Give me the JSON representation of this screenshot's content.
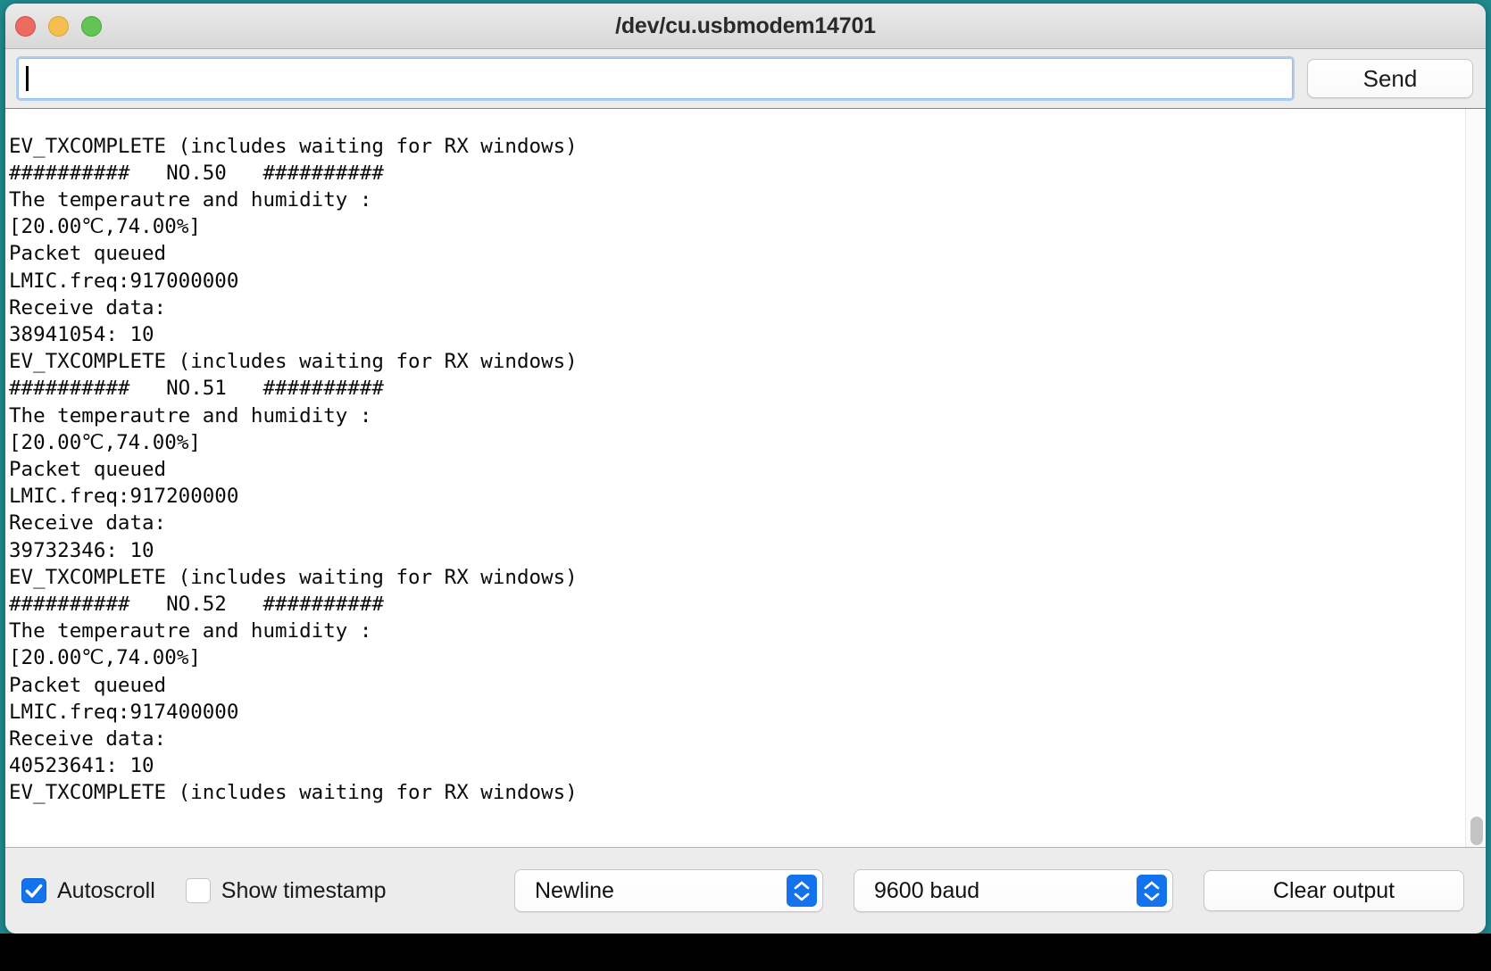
{
  "window": {
    "title": "/dev/cu.usbmodem14701",
    "traffic_lights": [
      {
        "name": "close",
        "color": "#ec6a5f"
      },
      {
        "name": "minimize",
        "color": "#f5bf4f"
      },
      {
        "name": "zoom",
        "color": "#61c454"
      }
    ]
  },
  "send_row": {
    "input_value": "",
    "input_placeholder": "",
    "send_label": "Send"
  },
  "console": {
    "text": "EV_TXCOMPLETE (includes waiting for RX windows)\n##########   NO.50   ##########\nThe temperautre and humidity :\n[20.00℃,74.00%]\nPacket queued\nLMIC.freq:917000000\nReceive data:\n38941054: 10\nEV_TXCOMPLETE (includes waiting for RX windows)\n##########   NO.51   ##########\nThe temperautre and humidity :\n[20.00℃,74.00%]\nPacket queued\nLMIC.freq:917200000\nReceive data:\n39732346: 10\nEV_TXCOMPLETE (includes waiting for RX windows)\n##########   NO.52   ##########\nThe temperautre and humidity :\n[20.00℃,74.00%]\nPacket queued\nLMIC.freq:917400000\nReceive data:\n40523641: 10\nEV_TXCOMPLETE (includes waiting for RX windows)",
    "lines": [
      "EV_TXCOMPLETE (includes waiting for RX windows)",
      "##########   NO.50   ##########",
      "The temperautre and humidity :",
      "[20.00℃,74.00%]",
      "Packet queued",
      "LMIC.freq:917000000",
      "Receive data:",
      "38941054: 10",
      "EV_TXCOMPLETE (includes waiting for RX windows)",
      "##########   NO.51   ##########",
      "The temperautre and humidity :",
      "[20.00℃,74.00%]",
      "Packet queued",
      "LMIC.freq:917200000",
      "Receive data:",
      "39732346: 10",
      "EV_TXCOMPLETE (includes waiting for RX windows)",
      "##########   NO.52   ##########",
      "The temperautre and humidity :",
      "[20.00℃,74.00%]",
      "Packet queued",
      "LMIC.freq:917400000",
      "Receive data:",
      "40523641: 10",
      "EV_TXCOMPLETE (includes waiting for RX windows)"
    ]
  },
  "toolbar": {
    "autoscroll_label": "Autoscroll",
    "autoscroll_checked": true,
    "show_timestamp_label": "Show timestamp",
    "show_timestamp_checked": false,
    "line_ending_value": "Newline",
    "baud_value": "9600 baud",
    "clear_output_label": "Clear output",
    "accent_color": "#1273ec"
  }
}
